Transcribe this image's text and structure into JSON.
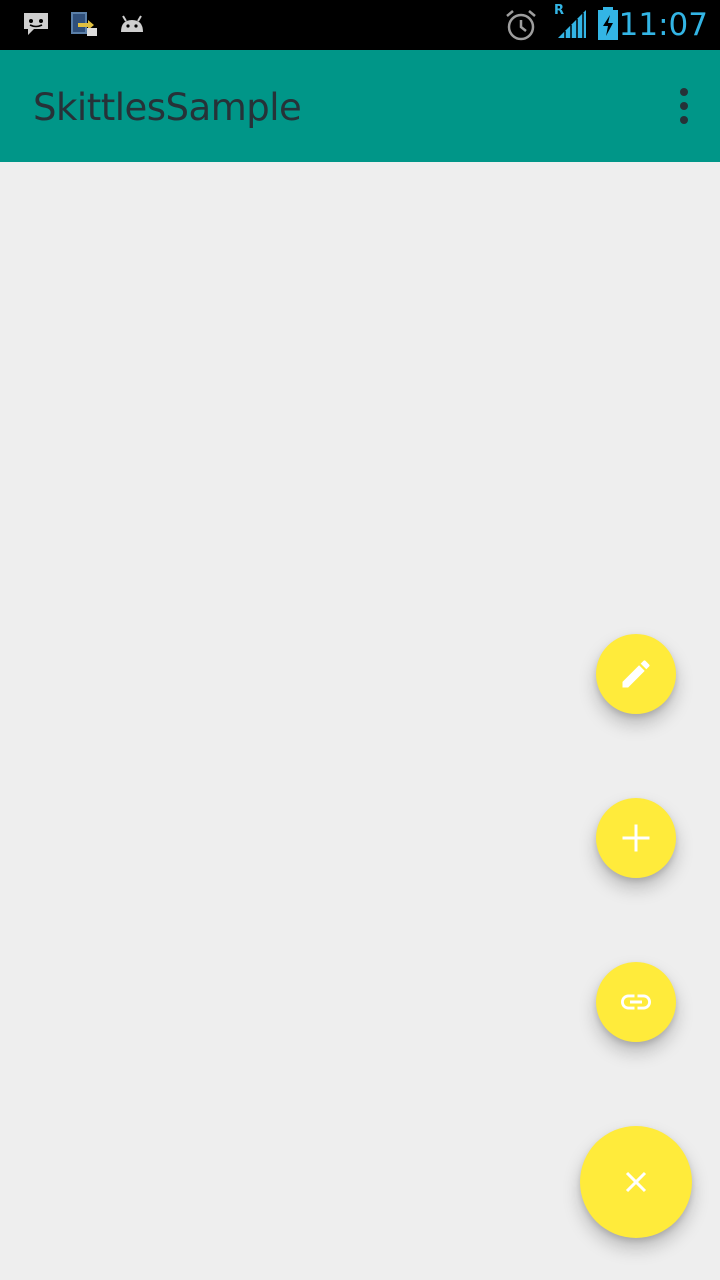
{
  "status_bar": {
    "time": "11:07",
    "notification_icons": [
      "message-icon",
      "sd-card-icon",
      "android-icon"
    ],
    "system_icons": [
      "alarm-icon",
      "signal-roaming-icon",
      "battery-charging-icon"
    ],
    "roaming_label": "R"
  },
  "app_bar": {
    "title": "SkittlesSample",
    "menu_icon": "overflow-menu-icon",
    "background_color": "#009688"
  },
  "fabs": [
    {
      "icon": "edit-icon"
    },
    {
      "icon": "add-icon"
    },
    {
      "icon": "link-icon"
    },
    {
      "icon": "close-icon"
    }
  ],
  "colors": {
    "accent": "#ffeb3b",
    "primary": "#009688",
    "status_time": "#33b5e5",
    "background": "#eeeeee"
  }
}
